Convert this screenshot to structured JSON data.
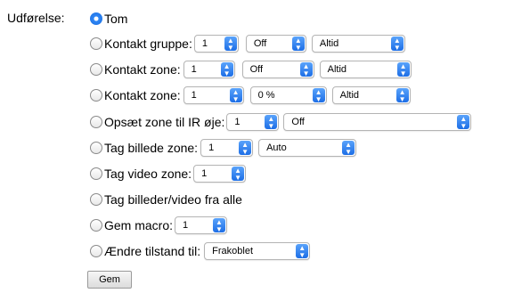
{
  "form": {
    "label": "Udførelse:",
    "options": [
      {
        "label": "Tom",
        "checked": true,
        "selects": []
      },
      {
        "label": "Kontakt gruppe:",
        "checked": false,
        "selects": [
          "1",
          "Off",
          "Altid"
        ]
      },
      {
        "label": "Kontakt zone:",
        "checked": false,
        "selects": [
          "1",
          "Off",
          "Altid"
        ]
      },
      {
        "label": "Kontakt zone:",
        "checked": false,
        "selects": [
          "1",
          "0 %",
          "Altid"
        ]
      },
      {
        "label": "Opsæt zone til IR øje:",
        "checked": false,
        "selects": [
          "1",
          "Off"
        ]
      },
      {
        "label": "Tag billede zone:",
        "checked": false,
        "selects": [
          "1",
          "Auto"
        ]
      },
      {
        "label": "Tag video zone:",
        "checked": false,
        "selects": [
          "1"
        ]
      },
      {
        "label": "Tag billeder/video fra alle",
        "checked": false,
        "selects": []
      },
      {
        "label": "Gem macro:",
        "checked": false,
        "selects": [
          "1"
        ]
      },
      {
        "label": "Ændre tilstand til:",
        "checked": false,
        "selects": [
          "Frakoblet"
        ]
      }
    ],
    "submit_label": "Gem"
  },
  "colors": {
    "accent": "#1d6ee6",
    "radio_checked": "#2f86f5"
  },
  "icons": {
    "select_arrow": "updown-chevron-icon"
  }
}
